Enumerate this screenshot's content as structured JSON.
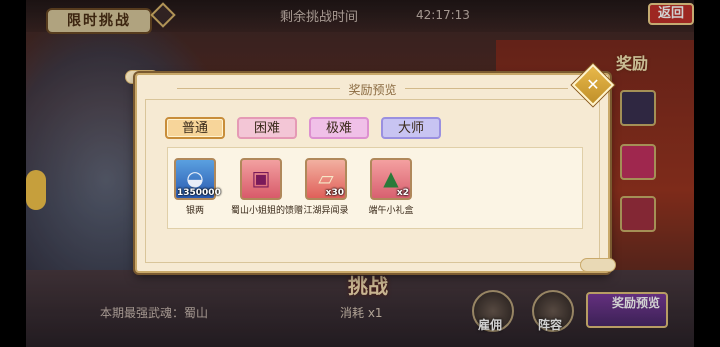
{
  "topbar": {
    "event_title": "限时挑战",
    "timer_label": "剩余挑战时间",
    "timer_value": "42:17:13",
    "back_label": "返回"
  },
  "background": {
    "right_reward_title": "奖励",
    "bottom_left_text": "本期最强武魂：蜀山",
    "challenge_label": "挑战",
    "consume_text": "消耗 x1",
    "side_buttons": [
      "雇佣",
      "阵容"
    ],
    "reward_preview_button": "奖励预览"
  },
  "modal": {
    "title": "奖励预览",
    "tabs": [
      {
        "label": "普通",
        "selected": true
      },
      {
        "label": "困难",
        "selected": false
      },
      {
        "label": "极难",
        "selected": false
      },
      {
        "label": "大师",
        "selected": false
      }
    ],
    "items": [
      {
        "name": "银两",
        "count": "1350000",
        "icon": "silver-ingot-icon"
      },
      {
        "name": "蜀山小姐姐的馈赠",
        "count": "",
        "icon": "gift-chest-icon"
      },
      {
        "name": "江湖异闻录",
        "count": "x30",
        "icon": "book-icon"
      },
      {
        "name": "端午小礼盒",
        "count": "x2",
        "icon": "zongzi-gift-icon"
      }
    ]
  },
  "colors": {
    "modal_bg": "#f6ead3",
    "tab_normal": "#f7d59a",
    "tab_hard": "#f3c6d6",
    "tab_extreme": "#f0c0e8",
    "tab_master": "#c8c4f2",
    "back_button": "#c0302a"
  }
}
